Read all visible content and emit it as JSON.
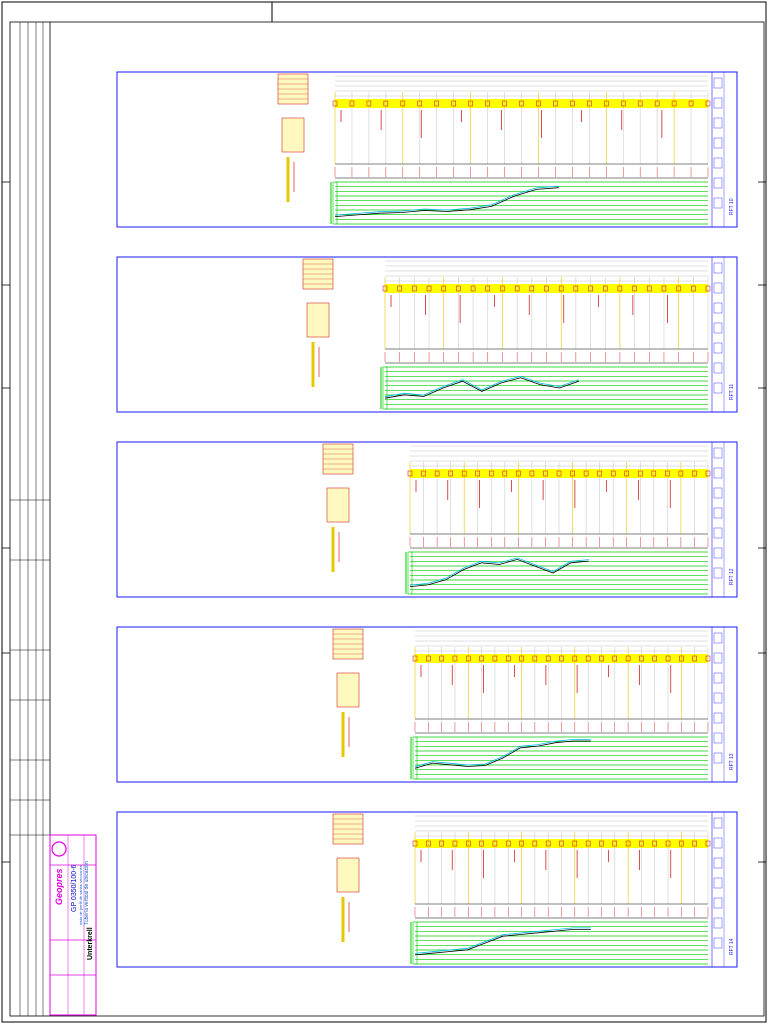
{
  "colors": {
    "frame": "#000000",
    "panel": "#1a1aff",
    "highlight": "#ffff00",
    "grid_green": "#00cc00",
    "annotation_red": "#cc0000",
    "profile_black": "#000000",
    "profile_cyan": "#00bbee",
    "titleblock_magenta": "#e000e0"
  },
  "titleblock": {
    "company": "Unterkrell",
    "project_line": "Tubería vertical de ubicación",
    "subtitle_line": "vista de perfil de varias secciones",
    "logo": "Geopres",
    "drawing_number": "GP 0350/100-6",
    "sheet_label": "SCALE"
  },
  "panels": [
    {
      "label": "RFT 10"
    },
    {
      "label": "RFT 11"
    },
    {
      "label": "RFT 12"
    },
    {
      "label": "RFT 13"
    },
    {
      "label": "RFT 14"
    }
  ]
}
